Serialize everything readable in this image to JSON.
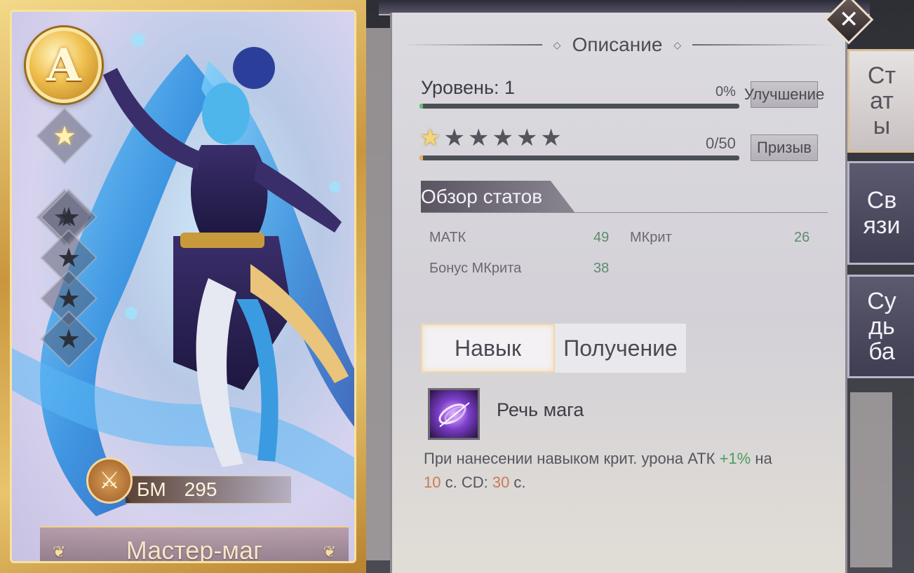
{
  "card": {
    "grade": "A",
    "stars_total": 6,
    "stars_lit": 1,
    "bm_label": "БМ",
    "bm_value": "295",
    "hero_name": "Мастер-маг",
    "class_icon": "crossed-swords-icon"
  },
  "panel": {
    "section_title": "Описание",
    "level_label": "Уровень: 1",
    "level_progress_pct": "0%",
    "level_progress": 0.0,
    "upgrade_button": "Улучшение",
    "stars_row": {
      "total": 6,
      "lit": 1
    },
    "shards": "0/50",
    "shards_progress": 0.0,
    "summon_button": "Призыв",
    "overview_title": "Обзор статов",
    "stats": [
      {
        "label": "МАТК",
        "value": "49"
      },
      {
        "label": "МКрит",
        "value": "26"
      },
      {
        "label": "Бонус МКрита",
        "value": "38"
      }
    ],
    "tabs": [
      {
        "label": "Навык",
        "active": true
      },
      {
        "label": "Получение",
        "active": false
      }
    ],
    "skill": {
      "name": "Речь мага",
      "desc_1": "При нанесении навыком крит. урона АТК ",
      "desc_bonus": "+1%",
      "desc_2": " на",
      "desc_duration": "10",
      "desc_3": " с. CD: ",
      "desc_cd": "30",
      "desc_4": " с."
    }
  },
  "side_tabs": [
    {
      "label_lines": [
        "Ст",
        "ат",
        "ы"
      ],
      "active": true
    },
    {
      "label_lines": [
        "Св",
        "язи"
      ],
      "active": false
    },
    {
      "label_lines": [
        "Су",
        "дь",
        "ба"
      ],
      "active": false
    }
  ],
  "colors": {
    "card_gold": "#e8c46d",
    "panel_bg": "#d8d6dc",
    "stat_value_green": "#5d8c6d",
    "highlight_green": "#4d9c5f",
    "highlight_orange": "#c97a55",
    "side_tab": "#4f4d62"
  }
}
